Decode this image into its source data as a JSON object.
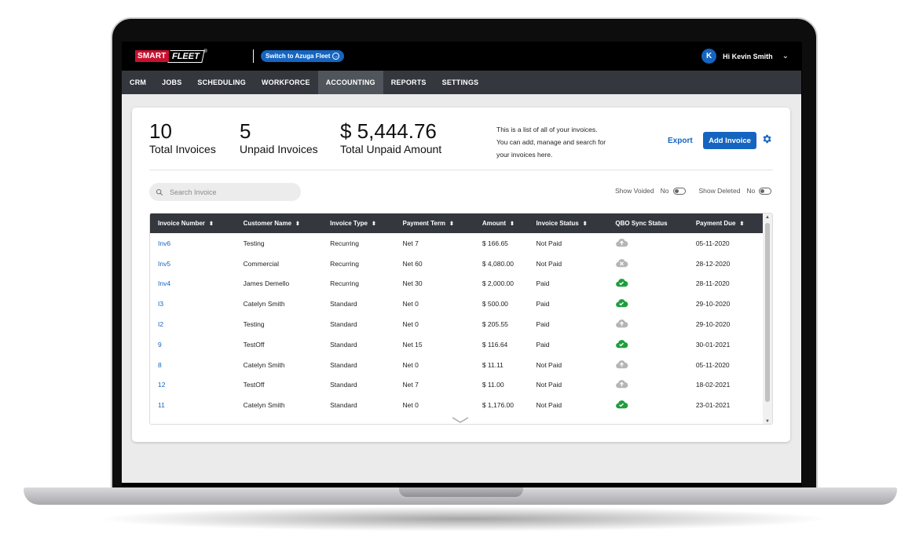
{
  "brand": {
    "logo_left": "SMART",
    "logo_right": "FLEET",
    "logo_mark": "®"
  },
  "topbar": {
    "switch_label": "Switch to Azuga Fleet",
    "avatar_initial": "K",
    "user_greeting": "Hi Kevin Smith"
  },
  "nav": [
    {
      "label": "CRM"
    },
    {
      "label": "JOBS"
    },
    {
      "label": "SCHEDULING"
    },
    {
      "label": "WORKFORCE"
    },
    {
      "label": "ACCOUNTING"
    },
    {
      "label": "REPORTS"
    },
    {
      "label": "SETTINGS"
    }
  ],
  "nav_active": "ACCOUNTING",
  "stats": {
    "total_invoices": {
      "value": "10",
      "label": "Total Invoices"
    },
    "unpaid_invoices": {
      "value": "5",
      "label": "Unpaid Invoices"
    },
    "total_unpaid": {
      "value": "$ 5,444.76",
      "label": "Total Unpaid Amount"
    }
  },
  "intro": {
    "line1": "This is a list of all of your invoices.",
    "line2": "You can add, manage and search for",
    "line3": "your invoices here."
  },
  "actions": {
    "export_label": "Export",
    "add_label": "Add Invoice"
  },
  "search": {
    "placeholder": "Search Invoice"
  },
  "filters": {
    "show_voided_label": "Show Voided",
    "show_voided_value": "No",
    "show_deleted_label": "Show Deleted",
    "show_deleted_value": "No"
  },
  "table": {
    "headers": [
      "Invoice Number",
      "Customer Name",
      "Invoice Type",
      "Payment Term",
      "Amount",
      "Invoice Status",
      "QBO Sync Status",
      "Payment Due"
    ],
    "rows": [
      {
        "number": "Inv6",
        "customer": "Testing",
        "type": "Recurring",
        "term": "Net 7",
        "amount": "$ 166.65",
        "status": "Not Paid",
        "sync": "not-synced",
        "due": "05-11-2020"
      },
      {
        "number": "Inv5",
        "customer": "Commercial",
        "type": "Recurring",
        "term": "Net 60",
        "amount": "$ 4,080.00",
        "status": "Not Paid",
        "sync": "failed",
        "due": "28-12-2020"
      },
      {
        "number": "Inv4",
        "customer": "James Demello",
        "type": "Recurring",
        "term": "Net 30",
        "amount": "$ 2,000.00",
        "status": "Paid",
        "sync": "synced",
        "due": "28-11-2020"
      },
      {
        "number": "I3",
        "customer": "Catelyn Smith",
        "type": "Standard",
        "term": "Net 0",
        "amount": "$ 500.00",
        "status": "Paid",
        "sync": "synced",
        "due": "29-10-2020"
      },
      {
        "number": "I2",
        "customer": "Testing",
        "type": "Standard",
        "term": "Net 0",
        "amount": "$ 205.55",
        "status": "Paid",
        "sync": "not-synced",
        "due": "29-10-2020"
      },
      {
        "number": "9",
        "customer": "TestOff",
        "type": "Standard",
        "term": "Net 15",
        "amount": "$ 116.64",
        "status": "Paid",
        "sync": "synced",
        "due": "30-01-2021"
      },
      {
        "number": "8",
        "customer": "Catelyn Smith",
        "type": "Standard",
        "term": "Net 0",
        "amount": "$ 11.11",
        "status": "Not Paid",
        "sync": "not-synced",
        "due": "05-11-2020"
      },
      {
        "number": "12",
        "customer": "TestOff",
        "type": "Standard",
        "term": "Net 7",
        "amount": "$ 11.00",
        "status": "Not Paid",
        "sync": "not-synced",
        "due": "18-02-2021"
      },
      {
        "number": "11",
        "customer": "Catelyn Smith",
        "type": "Standard",
        "term": "Net 0",
        "amount": "$ 1,176.00",
        "status": "Not Paid",
        "sync": "synced",
        "due": "23-01-2021"
      }
    ]
  },
  "colors": {
    "brand_red": "#c8102e",
    "accent_blue": "#1565c0",
    "nav_bg": "#34373d",
    "synced_green": "#1e9e3e",
    "unsynced_gray": "#b5b5b5"
  }
}
